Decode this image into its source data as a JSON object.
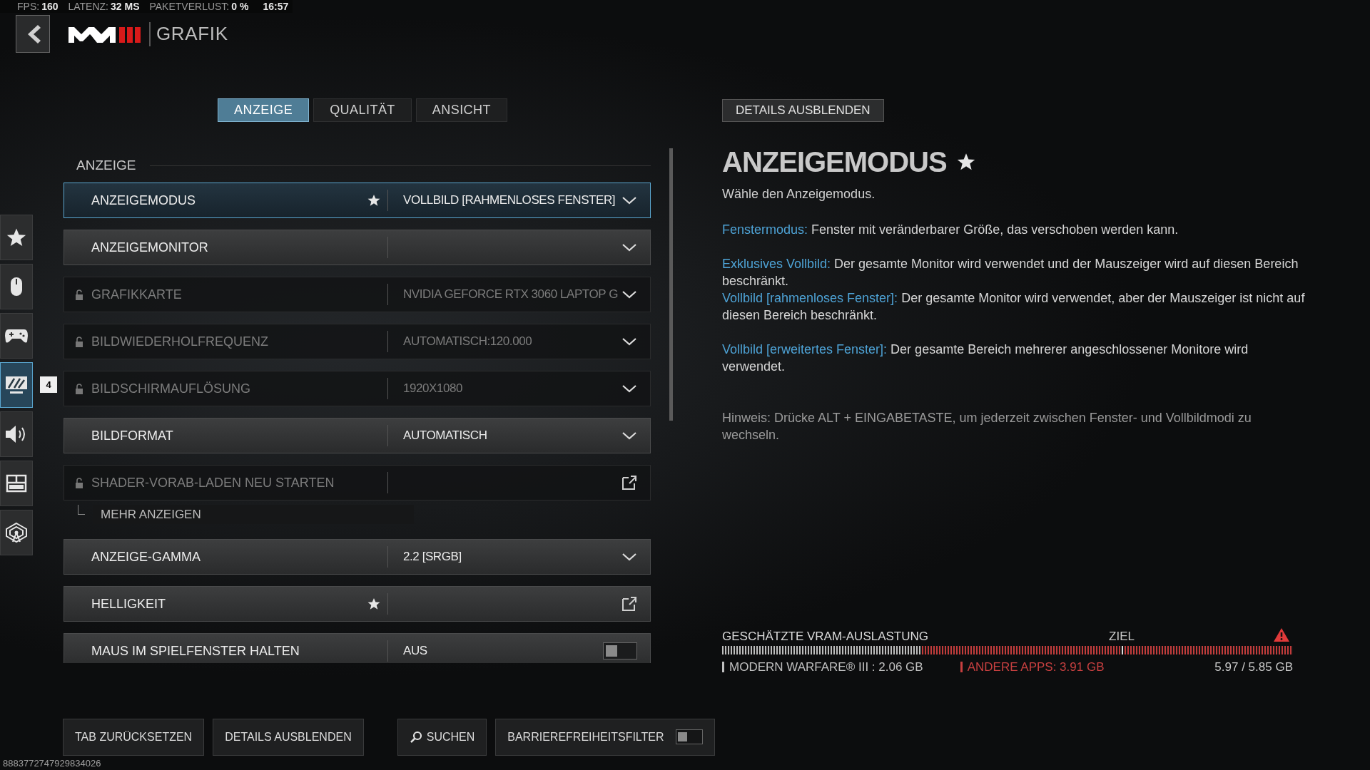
{
  "status_bar": [
    {
      "label": "FPS:",
      "value": "160"
    },
    {
      "label": "LATENZ:",
      "value": "32 MS"
    },
    {
      "label": "PAKETVERLUST:",
      "value": "0 %"
    }
  ],
  "clock": "16:57",
  "header": {
    "title": "GRAFIK"
  },
  "tabs": [
    {
      "label": "ANZEIGE",
      "selected": true
    },
    {
      "label": "QUALITÄT",
      "selected": false
    },
    {
      "label": "ANSICHT",
      "selected": false
    }
  ],
  "sidebar": [
    {
      "kind": "star",
      "selected": false
    },
    {
      "kind": "mouse",
      "selected": false
    },
    {
      "kind": "gamepad",
      "selected": false
    },
    {
      "kind": "display",
      "selected": true,
      "badge": "4"
    },
    {
      "kind": "speaker",
      "selected": false
    },
    {
      "kind": "layout",
      "selected": false
    },
    {
      "kind": "network",
      "selected": false
    }
  ],
  "section_heading": "ANZEIGE",
  "settings": [
    {
      "kind": "dropdown",
      "label": "ANZEIGEMODUS",
      "value": "VOLLBILD [RAHMENLOSES FENSTER]",
      "locked": false,
      "favorite": true,
      "selected": true
    },
    {
      "kind": "dropdown",
      "label": "ANZEIGEMONITOR",
      "locked": false,
      "favorite": false,
      "selected": false
    },
    {
      "kind": "dropdown",
      "label": "GRAFIKKARTE",
      "value": "NVIDIA GEFORCE RTX 3060 LAPTOP G",
      "locked": true,
      "favorite": false,
      "selected": false
    },
    {
      "kind": "dropdown",
      "label": "BILDWIEDERHOLFREQUENZ",
      "value": "AUTOMATISCH:120.000",
      "locked": true,
      "favorite": false,
      "selected": false
    },
    {
      "kind": "dropdown",
      "label": "BILDSCHIRMAUFLÖSUNG",
      "value": "1920X1080",
      "locked": true,
      "favorite": false,
      "selected": false
    },
    {
      "kind": "dropdown",
      "label": "BILDFORMAT",
      "value": "AUTOMATISCH",
      "locked": false,
      "favorite": false,
      "selected": false
    },
    {
      "kind": "action",
      "label": "SHADER-VORAB-LADEN NEU STARTEN",
      "locked": true,
      "favorite": false,
      "selected": false
    },
    {
      "kind": "more",
      "label": "MEHR ANZEIGEN"
    },
    {
      "kind": "dropdown",
      "label": "ANZEIGE-GAMMA",
      "value": "2.2 [SRGB]",
      "locked": false,
      "favorite": false,
      "selected": false
    },
    {
      "kind": "action",
      "label": "HELLIGKEIT",
      "locked": false,
      "favorite": true,
      "selected": false
    },
    {
      "kind": "toggle",
      "label": "MAUS IM SPIELFENSTER HALTEN",
      "value": "AUS",
      "on": false,
      "locked": false,
      "favorite": false,
      "selected": false
    }
  ],
  "details": {
    "hide_button": "DETAILS AUSBLENDEN",
    "title": "ANZEIGEMODUS",
    "favorite": true,
    "intro": "Wähle den Anzeigemodus.",
    "paragraphs": [
      {
        "entries": [
          {
            "term": "Fenstermodus:",
            "text": "Fenster mit veränderbarer Größe, das verschoben werden kann."
          }
        ]
      },
      {
        "entries": [
          {
            "term": "Exklusives Vollbild:",
            "text": "Der gesamte Monitor wird verwendet und der Mauszeiger wird auf diesen Bereich beschränkt."
          },
          {
            "term": "Vollbild [rahmenloses Fenster]:",
            "text": "Der gesamte Monitor wird verwendet, aber der Mauszeiger ist nicht auf diesen Bereich beschränkt."
          }
        ]
      },
      {
        "entries": [
          {
            "term": "Vollbild [erweitertes Fenster]:",
            "text": "Der gesamte Bereich mehrerer angeschlossener Monitore wird verwendet."
          }
        ]
      }
    ],
    "hint": "Hinweis: Drücke ALT + EINGABETASTE, um jederzeit zwischen Fenster- und Vollbildmodi zu wechseln."
  },
  "vram": {
    "title": "GESCHÄTZTE VRAM-AUSLASTUNG",
    "warning": true,
    "target": {
      "label": "ZIEL",
      "level": 0.7
    },
    "segments": [
      {
        "kind": "game",
        "level": 0.35,
        "label": "MODERN WARFARE® III : 2.06 GB"
      },
      {
        "kind": "other",
        "label": "ANDERE APPS: 3.91 GB"
      }
    ],
    "total": "5.97 / 5.85 GB"
  },
  "footer_buttons": [
    {
      "kind": "plain",
      "label": "TAB ZURÜCKSETZEN"
    },
    {
      "kind": "plain",
      "label": "DETAILS AUSBLENDEN"
    },
    {
      "kind": "search",
      "label": "SUCHEN"
    },
    {
      "kind": "toggle",
      "label": "BARRIEREFREIHEITSFILTER",
      "on": false
    }
  ],
  "build_id": "8883772747929834026"
}
